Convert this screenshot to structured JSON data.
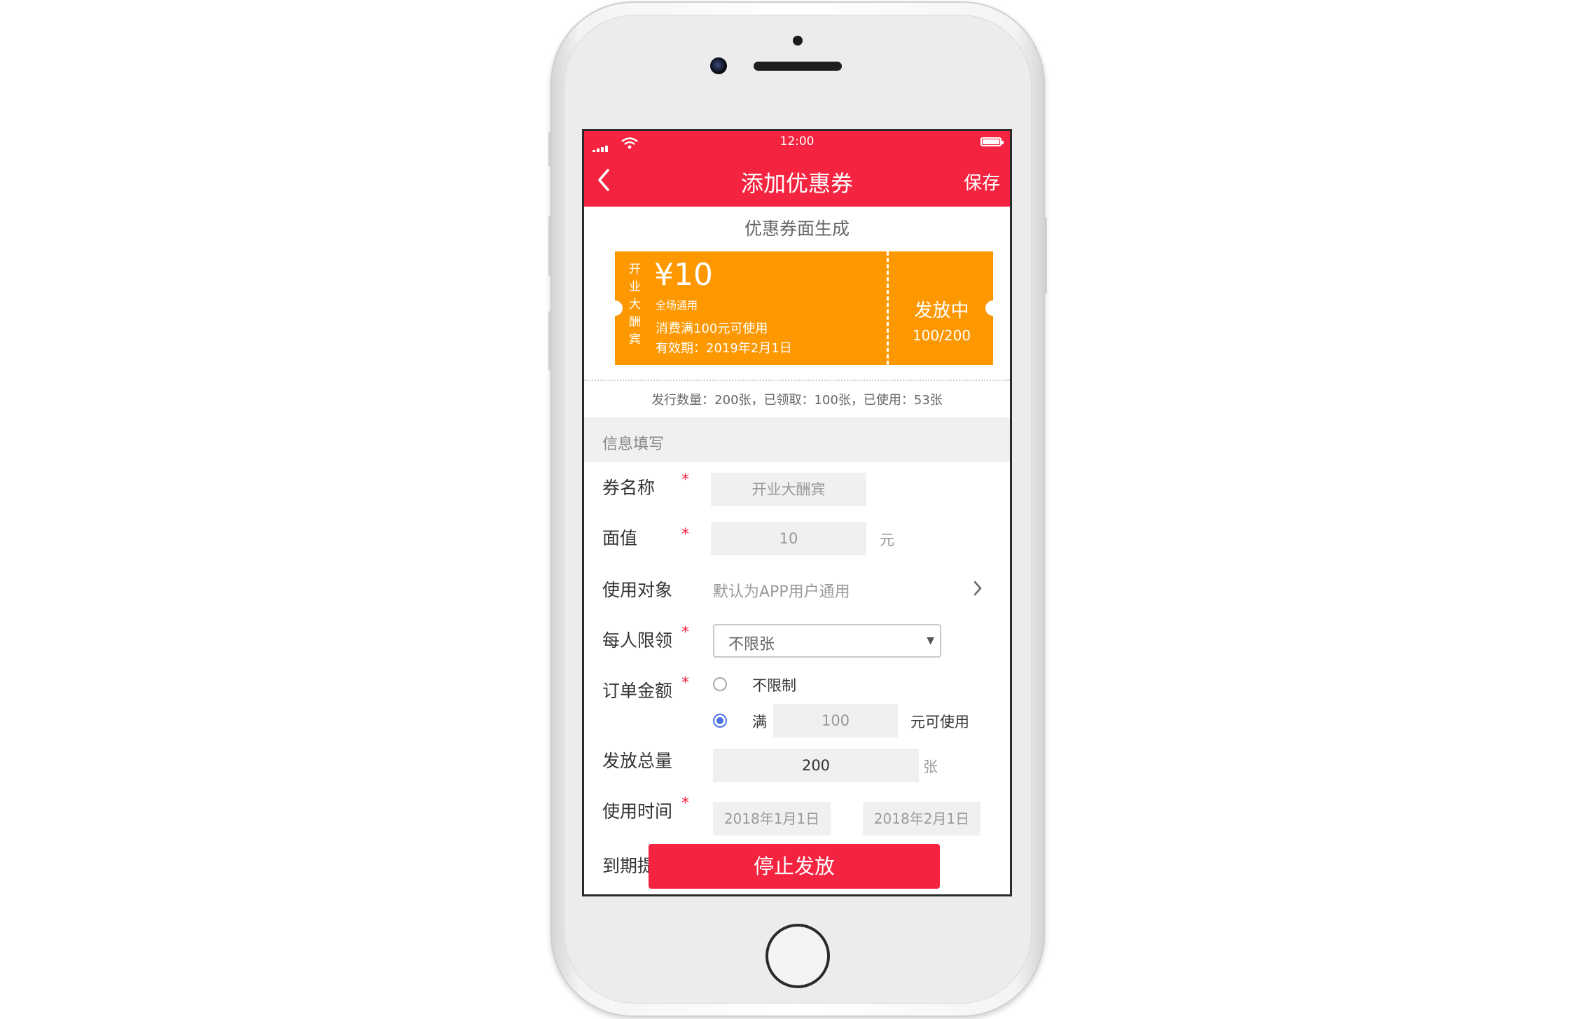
{
  "status_bar": {
    "time": "12:00"
  },
  "nav": {
    "title": "添加优惠券",
    "save": "保存"
  },
  "coupon_preview": {
    "section_title": "优惠券面生成",
    "name_vertical": "开业大酬宾",
    "amount": "¥10",
    "scope": "全场通用",
    "condition": "消费满100元可使用",
    "validity": "有效期：2019年2月1日",
    "status": "发放中",
    "count": "100/200"
  },
  "stats": "发行数量：200张，已领取：100张，已使用：53张",
  "info_section": "信息填写",
  "form": {
    "name": {
      "label": "券名称",
      "req": "*",
      "value": "开业大酬宾"
    },
    "value": {
      "label": "面值",
      "req": "*",
      "value": "10",
      "unit": "元"
    },
    "target": {
      "label": "使用对象",
      "hint": "默认为APP用户通用"
    },
    "limit": {
      "label": "每人限领",
      "req": "*",
      "selected": "不限张"
    },
    "order_amount": {
      "label": "订单金额",
      "req": "*",
      "opt_unlimited": "不限制",
      "opt_threshold": "满",
      "threshold_value": "100",
      "threshold_unit": "元可使用",
      "selected": "threshold"
    },
    "total": {
      "label": "发放总量",
      "value": "200",
      "unit": "张"
    },
    "time": {
      "label": "使用时间",
      "req": "*",
      "start": "2018年1月1日",
      "end": "2018年2月1日"
    },
    "expiry": {
      "label": "到期提"
    }
  },
  "actions": {
    "stop": "停止发放"
  },
  "colors": {
    "brand": "#f4233f",
    "coupon": "#fe9800",
    "radio": "#4a72e8"
  }
}
